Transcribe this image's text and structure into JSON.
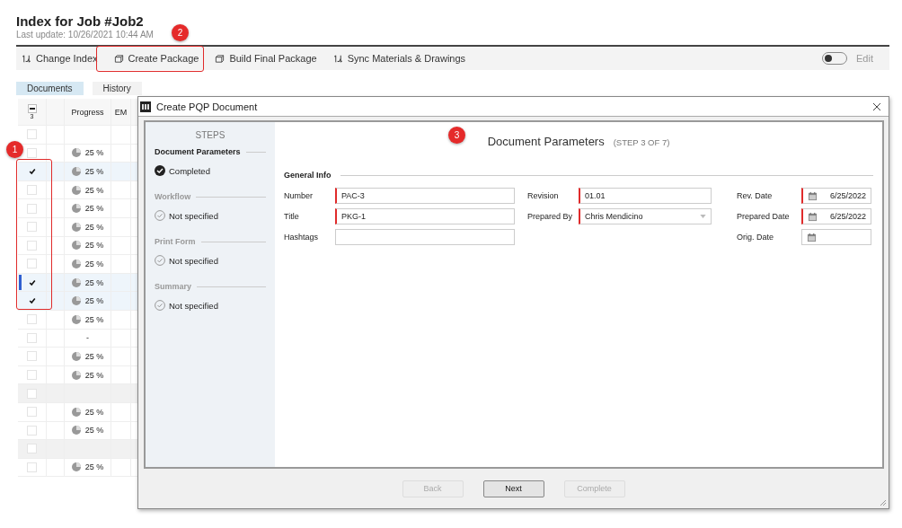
{
  "page": {
    "title": "Index for Job #Job2",
    "subtitle": "Last update: 10/26/2021 10:44 AM"
  },
  "toolbar": {
    "buttons": [
      {
        "label": "Change Index",
        "kind": "sync"
      },
      {
        "label": "Create Package",
        "kind": "package"
      },
      {
        "label": "Build Final Package",
        "kind": "package"
      },
      {
        "label": "Sync Materials & Drawings",
        "kind": "sync"
      }
    ],
    "edit_toggle": {
      "label": "Edit",
      "on": false
    }
  },
  "tabs": [
    {
      "label": "Documents",
      "selected": true
    },
    {
      "label": "History",
      "selected": false
    }
  ],
  "table": {
    "header_checkbox": {
      "indeterminate": true,
      "count": "3"
    },
    "columns": [
      "Progress",
      "EM"
    ],
    "rows": [
      {
        "kind": "item",
        "checked": false,
        "focused": false
      },
      {
        "kind": "item",
        "checked": false,
        "focused": false,
        "progress": "25 %"
      },
      {
        "kind": "item",
        "checked": true,
        "focused": false,
        "progress": "25 %"
      },
      {
        "kind": "item",
        "checked": false,
        "focused": false,
        "progress": "25 %"
      },
      {
        "kind": "item",
        "checked": false,
        "focused": false,
        "progress": "25 %"
      },
      {
        "kind": "item",
        "checked": false,
        "focused": false,
        "progress": "25 %"
      },
      {
        "kind": "item",
        "checked": false,
        "focused": false,
        "progress": "25 %"
      },
      {
        "kind": "item",
        "checked": false,
        "focused": false,
        "progress": "25 %"
      },
      {
        "kind": "item",
        "checked": true,
        "focused": true,
        "progress": "25 %"
      },
      {
        "kind": "item",
        "checked": true,
        "focused": false,
        "progress": "25 %"
      },
      {
        "kind": "item",
        "checked": false,
        "focused": false,
        "progress": "25 %"
      },
      {
        "kind": "item",
        "checked": false,
        "focused": false,
        "progress_text": "-"
      },
      {
        "kind": "item",
        "checked": false,
        "focused": false,
        "progress": "25 %"
      },
      {
        "kind": "item",
        "checked": false,
        "focused": false,
        "progress": "25 %"
      },
      {
        "kind": "group",
        "checked": false,
        "focused": false
      },
      {
        "kind": "item",
        "checked": false,
        "focused": false,
        "progress": "25 %"
      },
      {
        "kind": "item",
        "checked": false,
        "focused": false,
        "progress": "25 %"
      },
      {
        "kind": "group",
        "checked": false,
        "focused": false
      },
      {
        "kind": "item",
        "checked": false,
        "focused": false,
        "progress": "25 %"
      }
    ]
  },
  "dialog": {
    "title": "Create PQP Document",
    "steps_heading": "STEPS",
    "steps": [
      {
        "name": "Document Parameters",
        "status": "Completed",
        "completed": true,
        "current": true
      },
      {
        "name": "Workflow",
        "status": "Not specified",
        "completed": false,
        "current": false
      },
      {
        "name": "Print Form",
        "status": "Not specified",
        "completed": false,
        "current": false
      },
      {
        "name": "Summary",
        "status": "Not specified",
        "completed": false,
        "current": false
      }
    ],
    "heading": "Document Parameters",
    "step_label": "(STEP 3 OF 7)",
    "section": "General Info",
    "field_columns": [
      [
        {
          "label": "Number",
          "kind": "text",
          "value": "PAC-3",
          "required": true
        },
        {
          "label": "Title",
          "kind": "text",
          "value": "PKG-1",
          "required": true
        },
        {
          "label": "Hashtags",
          "kind": "text",
          "required": false
        }
      ],
      [
        {
          "label": "Revision",
          "kind": "text",
          "value": "01.01",
          "required": true
        },
        {
          "label": "Prepared By",
          "kind": "select",
          "value": "Chris Mendicino",
          "required": true
        }
      ],
      [
        {
          "label": "Rev. Date",
          "kind": "date",
          "value": "6/25/2022",
          "required": true
        },
        {
          "label": "Prepared Date",
          "kind": "date",
          "value": "6/25/2022",
          "required": true
        },
        {
          "label": "Orig. Date",
          "kind": "date",
          "required": false
        }
      ]
    ],
    "buttons": [
      {
        "label": "Back",
        "disabled": true
      },
      {
        "label": "Next",
        "disabled": false
      },
      {
        "label": "Complete",
        "disabled": true
      }
    ]
  },
  "callouts": [
    {
      "label": "1"
    },
    {
      "label": "2"
    },
    {
      "label": "3"
    }
  ]
}
